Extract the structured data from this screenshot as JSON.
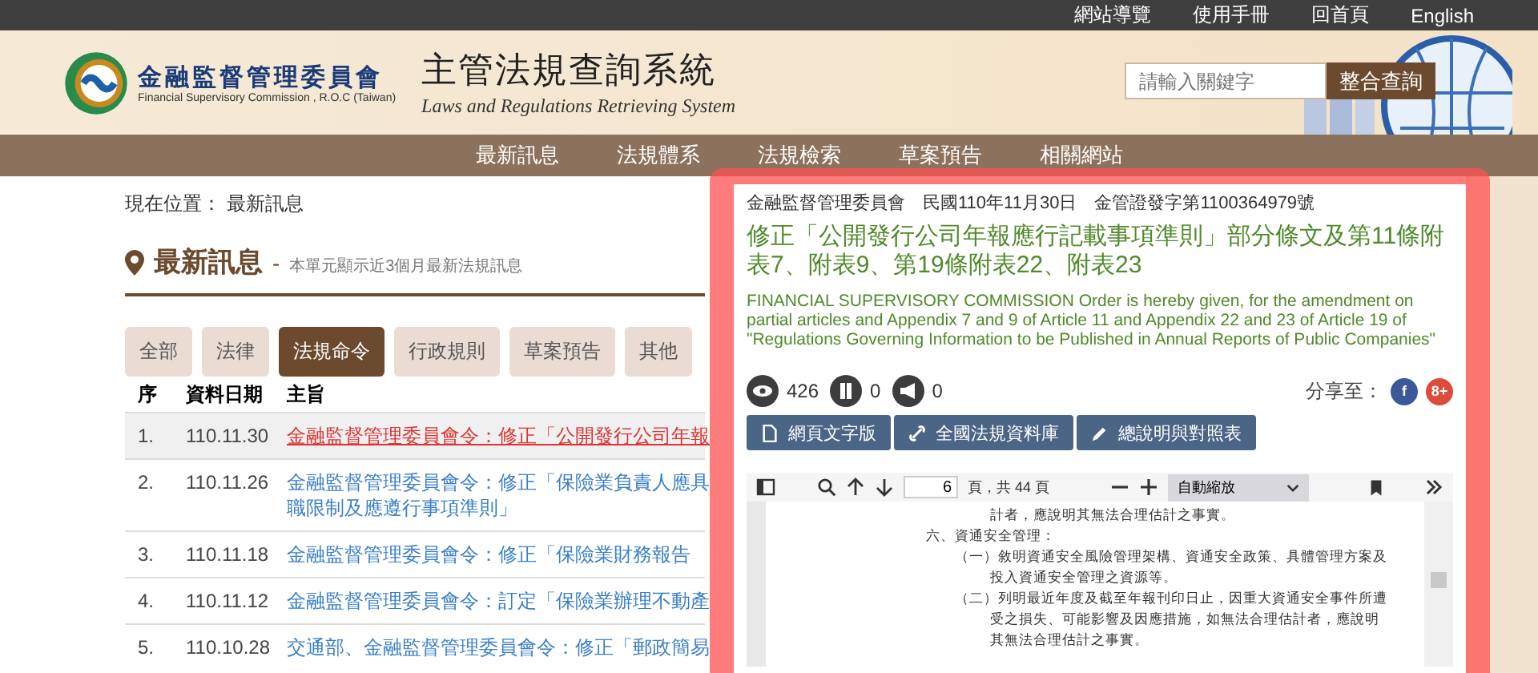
{
  "top_links": [
    "網站導覽",
    "使用手冊",
    "回首頁",
    "English"
  ],
  "logo": {
    "name_zh": "金融監督管理委員會",
    "name_en": "Financial Supervisory Commission , R.O.C (Taiwan)"
  },
  "site_title": {
    "zh": "主管法規查詢系統",
    "en": "Laws and Regulations Retrieving System"
  },
  "search": {
    "placeholder": "請輸入關鍵字",
    "button": "整合查詢"
  },
  "nav": [
    "最新訊息",
    "法規體系",
    "法規檢索",
    "草案預告",
    "相關網站"
  ],
  "breadcrumb": "現在位置： 最新訊息",
  "section": {
    "title": "最新訊息",
    "dash": "-",
    "subtitle": "本單元顯示近3個月最新法規訊息"
  },
  "tabs": [
    {
      "label": "全部",
      "selected": false
    },
    {
      "label": "法律",
      "selected": false
    },
    {
      "label": "法規命令",
      "selected": true
    },
    {
      "label": "行政規則",
      "selected": false
    },
    {
      "label": "草案預告",
      "selected": false
    },
    {
      "label": "其他",
      "selected": false
    }
  ],
  "table": {
    "columns": [
      "序",
      "資料日期",
      "主旨"
    ],
    "rows": [
      {
        "no": "1.",
        "date": "110.11.30",
        "lines": [
          "金融監督管理委員會令：修正「公開發行公司年報"
        ],
        "selected": true
      },
      {
        "no": "2.",
        "date": "110.11.26",
        "lines": [
          "金融監督管理委員會令：修正「保險業負責人應具",
          "職限制及應遵行事項準則」"
        ],
        "selected": false
      },
      {
        "no": "3.",
        "date": "110.11.18",
        "lines": [
          "金融監督管理委員會令：修正「保險業財務報告"
        ],
        "selected": false
      },
      {
        "no": "4.",
        "date": "110.11.12",
        "lines": [
          "金融監督管理委員會令：訂定「保險業辦理不動產"
        ],
        "selected": false
      },
      {
        "no": "5.",
        "date": "110.10.28",
        "lines": [
          "交通部、金融監督管理委員會令：修正「郵政簡易"
        ],
        "selected": false
      }
    ]
  },
  "modal": {
    "meta": "金融監督管理委員會　民國110年11月30日　金管證發字第1100364979號",
    "title": "修正「公開發行公司年報應行記載事項準則」部分條文及第11條附表7、附表9、第19條附表22、附表23",
    "english": "FINANCIAL SUPERVISORY COMMISSION Order is hereby given, for the amendment on partial articles and Appendix 7 and 9 of Article 11 and Appendix 22 and 23 of Article 19 of \"Regulations Governing Information to be Published in Annual Reports of Public Companies\"",
    "stats": [
      {
        "kind": "views",
        "value": "426"
      },
      {
        "kind": "bookmarks",
        "value": "0"
      },
      {
        "kind": "shares",
        "value": "0"
      }
    ],
    "share_label": "分享至：",
    "share": [
      {
        "kind": "facebook",
        "label": "f"
      },
      {
        "kind": "google",
        "label": "8+"
      }
    ],
    "buttons": [
      {
        "kind": "page",
        "label": "網頁文字版"
      },
      {
        "kind": "link",
        "label": "全國法規資料庫"
      },
      {
        "kind": "edit",
        "label": "總說明與對照表"
      }
    ],
    "viewer": {
      "page": "6",
      "page_total": "頁，共 44 頁",
      "zoom": "自動縮放",
      "lines": [
        {
          "kind": "cont",
          "text": "計者，應說明其無法合理估計之事實。"
        },
        {
          "kind": "heading",
          "text": "六、資通安全管理："
        },
        {
          "kind": "item",
          "text": "（一）敘明資通安全風險管理架構、資通安全政策、具體管理方案及"
        },
        {
          "kind": "cont",
          "text": "投入資通安全管理之資源等。"
        },
        {
          "kind": "item",
          "text": "（二）列明最近年度及截至年報刊印日止，因重大資通安全事件所遭"
        },
        {
          "kind": "cont",
          "text": "受之損失、可能影響及因應措施，如無法合理估計者，應說明"
        },
        {
          "kind": "cont",
          "text": "其無法合理估計之事實。"
        }
      ]
    }
  }
}
